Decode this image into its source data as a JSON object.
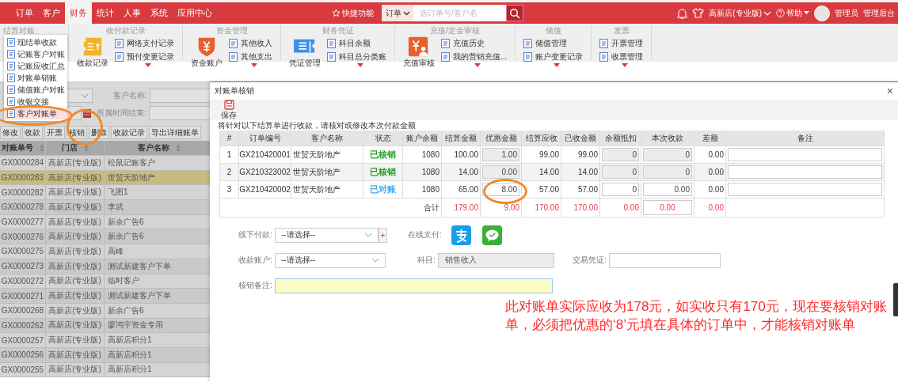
{
  "topbar": {
    "tabs": [
      {
        "label": "订单",
        "selected": false
      },
      {
        "label": "客户",
        "selected": false
      },
      {
        "label": "财务",
        "selected": true
      },
      {
        "label": "统计",
        "selected": false
      },
      {
        "label": "人事",
        "selected": false
      },
      {
        "label": "系统",
        "selected": false
      },
      {
        "label": "应用中心",
        "selected": false
      }
    ],
    "quick": "快捷功能",
    "search_scope": "订单",
    "search_placeholder": "选订单号/客户名",
    "store": "高新店(专业版)",
    "help": "帮助",
    "user": "管理员",
    "admin": "管理后台"
  },
  "ribbon": [
    {
      "title": "结算对账"
    },
    {
      "title": "收付款记录",
      "big": {
        "label": "收款记录"
      },
      "items": [
        "网络支付记录",
        "预付变更记录"
      ],
      "more": true
    },
    {
      "title": "资金管理",
      "big": {
        "label": "资金账户"
      },
      "items": [
        "其他收入",
        "其他支出"
      ],
      "more": true
    },
    {
      "title": "财务凭证",
      "big": {
        "label": "凭证管理"
      },
      "items": [
        "科目余额",
        "科目总分类账"
      ],
      "more": true
    },
    {
      "title": "充值/定金审核",
      "big": {
        "label": "充值审核"
      },
      "items": [
        "充值历史",
        "我的营销充值..."
      ],
      "more": true
    },
    {
      "title": "储值",
      "items": [
        "储值管理",
        "账户变更记录"
      ],
      "more": true
    },
    {
      "title": "发票",
      "items": [
        "开票管理",
        "收票管理"
      ],
      "more": true
    }
  ],
  "menu": [
    {
      "label": "现结单收款",
      "selected": false
    },
    {
      "label": "记账客户对账",
      "selected": false
    },
    {
      "label": "记账应收汇总",
      "selected": false
    },
    {
      "label": "对账单销账",
      "selected": false
    },
    {
      "label": "储值账户对账",
      "selected": false
    },
    {
      "label": "收银交接",
      "selected": false
    },
    {
      "label": "客户对账单",
      "selected": true
    }
  ],
  "filters": {
    "customer_label": "客户名称:",
    "end_label": "所属时间结束:"
  },
  "actions": [
    "修改",
    "收款",
    "开票",
    "核销",
    "删除",
    "收款记录",
    "导出详细账单"
  ],
  "list": {
    "columns": [
      "对账单号",
      "门店",
      "客户名称"
    ],
    "rows": [
      {
        "id": "GX0000284",
        "store": "高新店(专业版)",
        "customer": "松鼠记账客户",
        "selected": false
      },
      {
        "id": "GX0000283",
        "store": "高新店(专业版)",
        "customer": "世贸天阶地产",
        "selected": true
      },
      {
        "id": "GX0000282",
        "store": "高新店(专业版)",
        "customer": "飞图1",
        "selected": false
      },
      {
        "id": "GX0000278",
        "store": "高新店(专业版)",
        "customer": "李武",
        "selected": false
      },
      {
        "id": "GX0000277",
        "store": "高新店(专业版)",
        "customer": "新余广告6",
        "selected": false
      },
      {
        "id": "GX0000276",
        "store": "高新店(专业版)",
        "customer": "新余广告6",
        "selected": false
      },
      {
        "id": "GX0000275",
        "store": "高新店(专业版)",
        "customer": "高峰",
        "selected": false
      },
      {
        "id": "GX0000273",
        "store": "高新店(专业版)",
        "customer": "测试新建客户下单",
        "selected": false
      },
      {
        "id": "GX0000272",
        "store": "高新店(专业版)",
        "customer": "临时客户",
        "selected": false
      },
      {
        "id": "GX0000271",
        "store": "高新店(专业版)",
        "customer": "测试新建客户下单",
        "selected": false
      },
      {
        "id": "GX0000268",
        "store": "高新店(专业版)",
        "customer": "新余广告6",
        "selected": false
      },
      {
        "id": "GX0000262",
        "store": "高新店(专业版)",
        "customer": "廖鸿宇资金专用",
        "selected": false
      },
      {
        "id": "GX0000257",
        "store": "高新店(专业版)",
        "customer": "高新店积分1",
        "selected": false
      },
      {
        "id": "GX0000256",
        "store": "高新店(专业版)",
        "customer": "高新店积分1",
        "selected": false
      },
      {
        "id": "GX0000255",
        "store": "高新店(专业版)",
        "customer": "高新店积分1",
        "selected": false
      }
    ]
  },
  "dialog": {
    "title": "对账单核销",
    "close": "×",
    "save": "保存",
    "note": "将针对以下结算单进行收款，请核对或修改本次付款金额",
    "columns": [
      "#",
      "订单编号",
      "客户名称",
      "状态",
      "账户余额",
      "结算金额",
      "优惠金额",
      "结算应收",
      "已收金额",
      "余额抵扣",
      "本次收款",
      "差额",
      "备注"
    ],
    "rows": [
      {
        "no": "1",
        "order": "GX210420001",
        "customer": "世贸天阶地产",
        "status": "已核销",
        "color": "#2a9d2a",
        "balance": "1080",
        "amount": "100.00",
        "discount": "1.00",
        "receivable": "99.00",
        "received": "99.00",
        "deduct": "0",
        "payment": "0",
        "diff": "0.00",
        "locked": true
      },
      {
        "no": "2",
        "order": "GX210323002",
        "customer": "世贸天阶地产",
        "status": "已核销",
        "color": "#2a9d2a",
        "balance": "1080",
        "amount": "14.00",
        "discount": "0.00",
        "receivable": "14.00",
        "received": "14.00",
        "deduct": "0",
        "payment": "0",
        "diff": "0.00",
        "locked": true
      },
      {
        "no": "3",
        "order": "GX210420002",
        "customer": "世贸天阶地产",
        "status": "已对账",
        "color": "#3fa9f5",
        "balance": "1080",
        "amount": "65.00",
        "discount": "8.00",
        "receivable": "57.00",
        "received": "57.00",
        "deduct": "0",
        "payment": "0.00",
        "diff": "0.00",
        "locked": false
      }
    ],
    "total": {
      "label": "合计",
      "amount": "179.00",
      "discount": "9.00",
      "receivable": "170.00",
      "received": "170.00",
      "deduct": "0.00",
      "payment": "0.00",
      "diff": "0.00"
    },
    "form": {
      "offline_label": "线下付款:",
      "offline_placeholder": "--请选择--",
      "add": "+",
      "online_label": "在线支付:",
      "account_label": "收款账户:",
      "account_placeholder": "--请选择--",
      "subject_label": "科目:",
      "subject_value": "销售收入",
      "voucher_label": "交易凭证:",
      "remark_label": "核销备注:"
    }
  },
  "annotation": "此对账单实际应收为178元，如实收只有170元，现在要核销对账单，必须把优惠的‘8’元填在具体的订单中，才能核销对账单"
}
